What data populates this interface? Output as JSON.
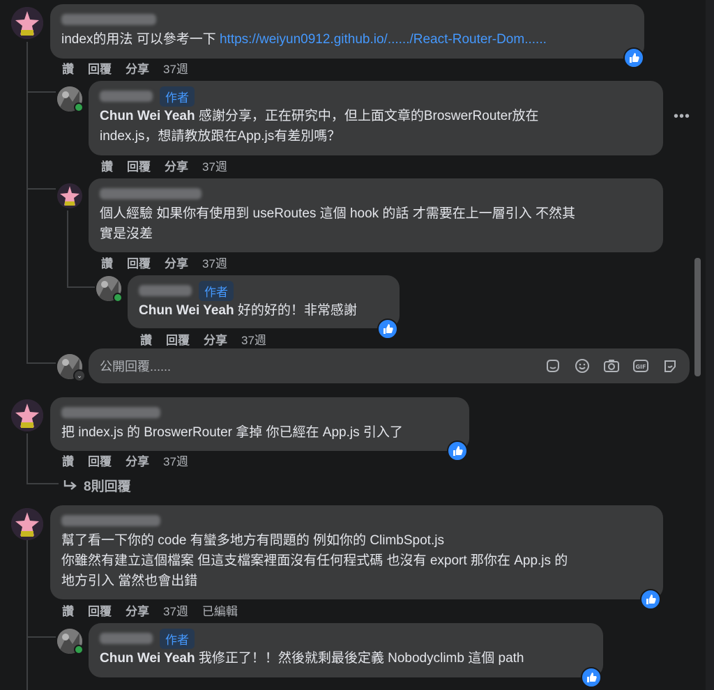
{
  "actions": {
    "like": "讚",
    "reply": "回覆",
    "share": "分享",
    "time": "37週",
    "edited": "已編輯"
  },
  "author_badge": "作者",
  "comments": [
    {
      "text_prefix": "index的用法 可以參考一下 ",
      "link": "https://weiyun0912.github.io/....../React-Router-Dom......",
      "replies": [
        {
          "author": "Chun Wei Yeah",
          "text": " 感謝分享，正在研究中，但上面文章的BroswerRouter放在\nindex.js，想請教放跟在App.js有差別嗎？"
        },
        {
          "text": "個人經驗 如果你有使用到 useRoutes 這個 hook 的話 才需要在上一層引入 不然其\n實是沒差"
        },
        {
          "author": "Chun Wei Yeah",
          "text": " 好的好的！非常感謝"
        }
      ]
    },
    {
      "text": "把 index.js 的 BroswerRouter 拿掉 你已經在 App.js 引入了",
      "replies_link": "8則回覆"
    },
    {
      "text": "幫了看一下你的 code 有蠻多地方有問題的 例如你的 ClimbSpot.js\n你雖然有建立這個檔案 但這支檔案裡面沒有任何程式碼 也沒有 export 那你在 App.js 的\n地方引入 當然也會出錯",
      "replies": [
        {
          "author": "Chun Wei Yeah",
          "text": " 我修正了！！然後就剩最後定義 Nobodyclimb 這個 path"
        }
      ]
    }
  ],
  "reply_input": {
    "placeholder": "公開回覆......"
  },
  "icons": [
    "avatar-starfish",
    "avatar-user",
    "like-icon",
    "more-icon",
    "sticker-icon",
    "emoji-icon",
    "camera-icon",
    "gif-icon",
    "avatar-sticker-icon",
    "reply-arrow-icon",
    "chevron-down-icon"
  ],
  "colors": {
    "background": "#18191a",
    "bubble": "#3a3b3c",
    "link": "#4599ff",
    "like": "#2d88ff",
    "online": "#31a24c",
    "muted": "#b0b3b8"
  }
}
